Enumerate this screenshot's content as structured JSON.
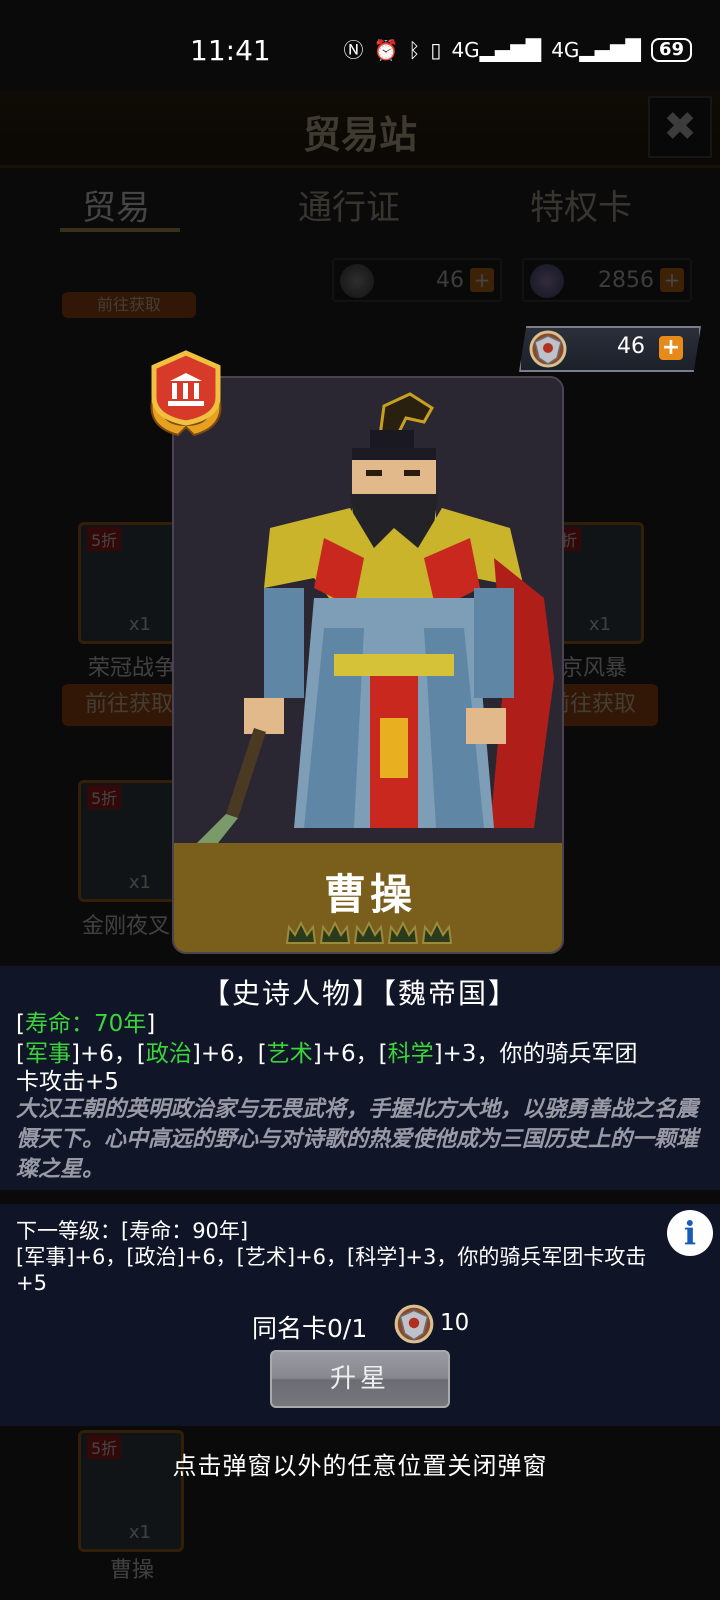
{
  "status_bar": {
    "time": "11:41",
    "icons": [
      "nfc-icon",
      "alarm-icon",
      "bluetooth-icon",
      "vibrate-icon",
      "signal-4g-icon",
      "signal-4g-icon"
    ],
    "battery": "69"
  },
  "background": {
    "title": "贸易站",
    "close_label": "✖",
    "tabs": [
      {
        "label": "贸易"
      },
      {
        "label": "通行证"
      },
      {
        "label": "特权卡"
      }
    ],
    "currency_a": "46",
    "currency_b": "2856",
    "get_button": "前往获取",
    "cards": [
      {
        "sale": "5折",
        "qty": "x1",
        "name": "荣冠战争"
      },
      {
        "sale": "5折",
        "qty": "x1",
        "name": "京风暴"
      },
      {
        "sale": "5折",
        "qty": "x1",
        "name": "金刚夜叉"
      },
      {
        "sale": "5折",
        "qty": "x1",
        "name": "曹操"
      }
    ]
  },
  "currency_chip": {
    "value": "46",
    "plus": "+"
  },
  "card": {
    "name": "曹操",
    "stars": 5
  },
  "info": {
    "tags": "【史诗人物】【魏帝国】",
    "lifespan_open": "[",
    "lifespan": "寿命：70年",
    "lifespan_close": "]",
    "stat_military": "军事",
    "stat_politics": "政治",
    "stat_art": "艺术",
    "stat_science": "科学",
    "stat_line_tail": "]+3，你的骑兵军团",
    "stat_line2": "卡攻击+5",
    "description": "大汉王朝的英明政治家与无畏武将，手握北方大地，以骁勇善战之名震慑天下。心中高远的野心与对诗歌的热爱使他成为三国历史上的一颗璀璨之星。"
  },
  "next_level": {
    "line1": "下一等级：[寿命：90年]",
    "line2": "[军事]+6，[政治]+6，[艺术]+6，[科学]+3，你的骑兵军团卡攻击",
    "line3": "+5"
  },
  "duplicate": {
    "label": "同名卡0/1",
    "cost": "10"
  },
  "upgrade_button": "升星",
  "close_hint": "点击弹窗以外的任意位置关闭弹窗"
}
